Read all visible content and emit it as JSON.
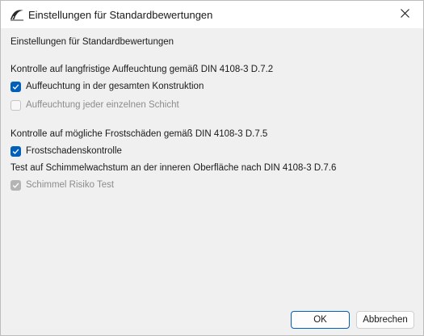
{
  "window": {
    "title": "Einstellungen für Standardbewertungen",
    "app_icon": "wufi-logo-icon",
    "close_icon": "close-icon"
  },
  "dialog": {
    "heading": "Einstellungen für Standardbewertungen",
    "long_term_moisture": {
      "label": "Kontrolle auf langfristige Auffeuchtung gemäß DIN 4108-3 D.7.2",
      "options": [
        {
          "label": "Auffeuchtung in der gesamten Konstruktion",
          "checked": true,
          "enabled": true
        },
        {
          "label": "Auffeuchtung jeder einzelnen Schicht",
          "checked": false,
          "enabled": false
        }
      ]
    },
    "frost_damage": {
      "label": "Kontrolle auf mögliche Frostschäden gemäß DIN 4108-3 D.7.5",
      "options": [
        {
          "label": "Frostschadenskontrolle",
          "checked": true,
          "enabled": true
        }
      ]
    },
    "mold": {
      "label": "Test auf Schimmelwachstum an der inneren Oberfläche nach DIN 4108-3 D.7.6",
      "options": [
        {
          "label": "Schimmel Risiko Test",
          "checked": true,
          "enabled": false
        }
      ]
    }
  },
  "buttons": {
    "ok": "OK",
    "cancel": "Abbrechen"
  },
  "colors": {
    "accent": "#005fb8",
    "background": "#f0f0f0",
    "titlebar": "#ffffff",
    "disabled_text": "#8c8c8c"
  }
}
